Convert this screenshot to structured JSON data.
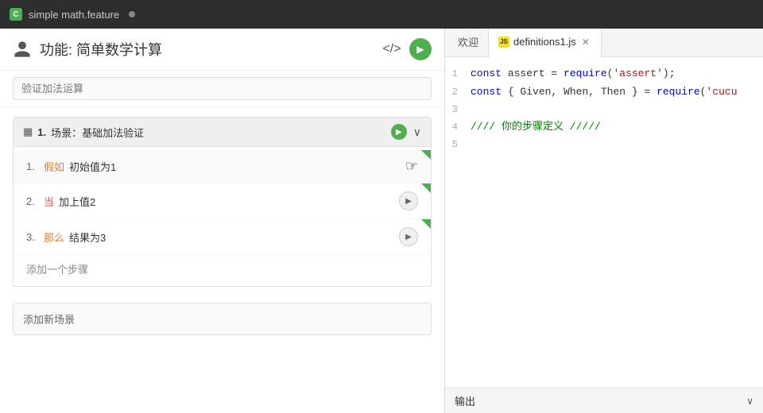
{
  "topbar": {
    "icon_label": "C",
    "title": "simple math.feature",
    "dot_visible": true
  },
  "left_panel": {
    "feature_header": {
      "title": "功能: 简单数学计算",
      "code_icon": "</>",
      "run_icon": "▶"
    },
    "search": {
      "placeholder": "验证加法运算"
    },
    "scenario": {
      "num_label": "1.",
      "icon": "▦",
      "title": "场景：基础加法验证",
      "run_btn": "▶",
      "chevron": "∨",
      "steps": [
        {
          "num": "1.",
          "keyword": "假如",
          "keyword_type": "given",
          "text": "初始值为1",
          "has_corner": true,
          "btn_icon": "☞"
        },
        {
          "num": "2.",
          "keyword": "当",
          "keyword_type": "when",
          "text": "加上值2",
          "has_corner": true,
          "btn_icon": "▶"
        },
        {
          "num": "3.",
          "keyword": "那么",
          "keyword_type": "then",
          "text": "结果为3",
          "has_corner": true,
          "btn_icon": "▶"
        }
      ],
      "add_step_label": "添加一个步骤"
    },
    "add_scenario_label": "添加新场景"
  },
  "right_panel": {
    "tabs": [
      {
        "id": "welcome",
        "label": "欢迎",
        "type": "text",
        "active": false,
        "closable": false
      },
      {
        "id": "definitions",
        "label": "definitions1.js",
        "type": "js",
        "active": true,
        "closable": true
      }
    ],
    "code": {
      "lines": [
        {
          "num": 1,
          "content": "const assert = require('assert');",
          "type": "code"
        },
        {
          "num": 2,
          "content": "const { Given, When, Then } = require('cucu",
          "type": "code"
        },
        {
          "num": 3,
          "content": "",
          "type": "empty"
        },
        {
          "num": 4,
          "content": "//// 你的步骤定义 /////",
          "type": "comment"
        },
        {
          "num": 5,
          "content": "",
          "type": "empty"
        }
      ],
      "assert_text": "assert",
      "require_assert": "require('assert');",
      "line2_pre": "const { Given, When, Then } = require('cucu",
      "require_keyword": "require"
    },
    "output_bar": {
      "label": "输出",
      "chevron": "∨"
    }
  }
}
